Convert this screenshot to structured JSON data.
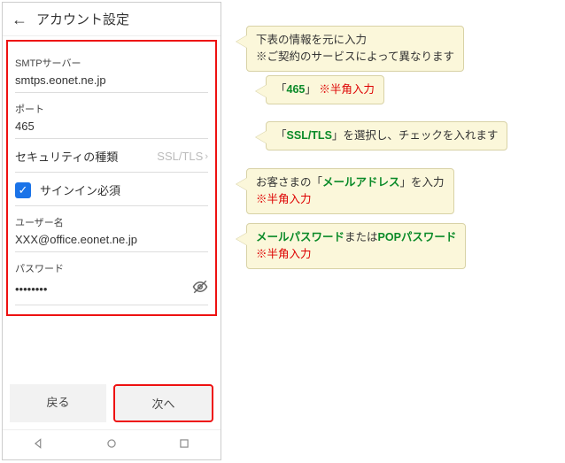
{
  "header": {
    "title": "アカウント設定"
  },
  "form": {
    "smtp_label": "SMTPサーバー",
    "smtp_value": "smtps.eonet.ne.jp",
    "port_label": "ポート",
    "port_value": "465",
    "security_label": "セキュリティの種類",
    "security_value": "SSL/TLS",
    "signin_required_label": "サインイン必須",
    "username_label": "ユーザー名",
    "username_value": "XXX@office.eonet.ne.jp",
    "password_label": "パスワード",
    "password_value": "••••••••"
  },
  "buttons": {
    "back": "戻る",
    "next": "次へ"
  },
  "callouts": {
    "c1_line1": "下表の情報を元に入力",
    "c1_line2": "※ご契約のサービスによって異なります",
    "c2_before": "「",
    "c2_value": "465",
    "c2_after": "」",
    "c2_note": "※半角入力",
    "c3_before": "「",
    "c3_value": "SSL/TLS",
    "c3_after": "」を選択し、チェックを入れます",
    "c4_before": "お客さまの「",
    "c4_value": "メールアドレス",
    "c4_after": "」を入力",
    "c4_note": "※半角入力",
    "c5_a": "メールパスワード",
    "c5_mid": "または",
    "c5_b": "POPパスワード",
    "c5_note": "※半角入力"
  }
}
